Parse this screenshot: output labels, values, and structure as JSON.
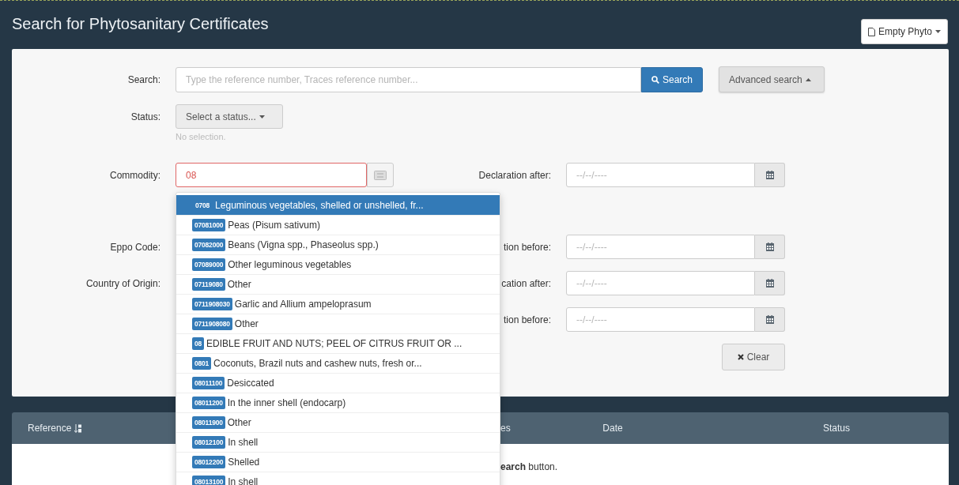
{
  "window": {
    "title": "Search for Phytosanitary Certificates"
  },
  "header_button": {
    "label": "Empty Phyto"
  },
  "search": {
    "label": "Search:",
    "placeholder": "Type the reference number, Traces reference number...",
    "button": "Search",
    "advanced_button": "Advanced search",
    "advanced_expanded": true
  },
  "status": {
    "label": "Status:",
    "dropdown": "Select a status...",
    "hint": "No selection."
  },
  "form_rows": [
    {
      "left_label": "Commodity:",
      "commodity": {
        "value": "08",
        "error": true
      },
      "right_label": "Declaration after:",
      "date_placeholder": "--/--/----"
    },
    {
      "left_label": "Eppo Code:",
      "right_label": "tion before:",
      "date_placeholder": "--/--/----"
    },
    {
      "left_label": "Country of Origin:",
      "right_label": "cation after:",
      "date_placeholder": "--/--/----"
    },
    {
      "right_label": "tion before:",
      "date_placeholder": "--/--/----"
    }
  ],
  "clear_button": "Clear",
  "suggestions": [
    {
      "code": "0708",
      "text": "Leguminous vegetables, shelled or unshelled, fr...",
      "selected": true
    },
    {
      "code": "07081000",
      "text": "Peas (Pisum sativum)",
      "selected": false
    },
    {
      "code": "07082000",
      "text": "Beans (Vigna spp., Phaseolus spp.)",
      "selected": false
    },
    {
      "code": "07089000",
      "text": "Other leguminous vegetables",
      "selected": false
    },
    {
      "code": "07119080",
      "text": "Other",
      "selected": false
    },
    {
      "code": "0711908030",
      "text": "Garlic and Allium ampeloprasum",
      "selected": false
    },
    {
      "code": "0711908080",
      "text": "Other",
      "selected": false
    },
    {
      "code": "08",
      "text": "EDIBLE FRUIT AND NUTS; PEEL OF CITRUS FRUIT OR ...",
      "selected": false
    },
    {
      "code": "0801",
      "text": "Coconuts, Brazil nuts and cashew nuts, fresh or...",
      "selected": false
    },
    {
      "code": "08011100",
      "text": "Desiccated",
      "selected": false
    },
    {
      "code": "08011200",
      "text": "In the inner shell (endocarp)",
      "selected": false
    },
    {
      "code": "08011900",
      "text": "Other",
      "selected": false
    },
    {
      "code": "08012100",
      "text": "In shell",
      "selected": false
    },
    {
      "code": "08012200",
      "text": "Shelled",
      "selected": false
    },
    {
      "code": "08013100",
      "text": "In shell",
      "selected": false
    }
  ],
  "table": {
    "columns": [
      "Reference",
      "es",
      "Date",
      "Status"
    ],
    "message": "**earch** button."
  }
}
